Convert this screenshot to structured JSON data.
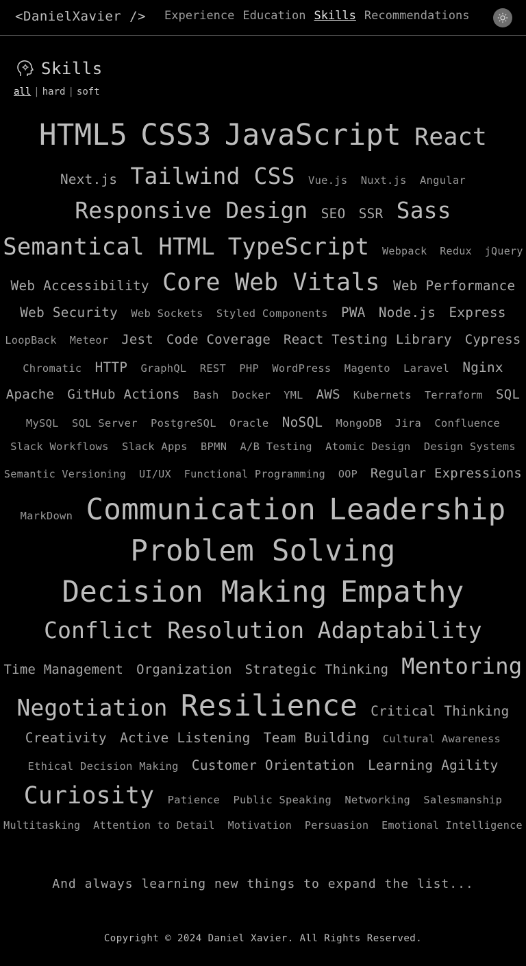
{
  "header": {
    "brand": "<DanielXavier />",
    "nav": [
      "Experience",
      "Education",
      "Skills",
      "Recommendations"
    ],
    "active_nav": "Skills",
    "theme_toggle_icon": "sun-icon"
  },
  "section": {
    "title": "Skills",
    "icon": "head-gear-icon",
    "filters": [
      "all",
      "hard",
      "soft"
    ],
    "active_filter": "all"
  },
  "skills_rows": [
    [
      [
        "HTML5",
        44
      ],
      [
        "CSS3",
        44
      ],
      [
        "JavaScript",
        44
      ],
      [
        "React",
        36
      ]
    ],
    [
      [
        "Next.js",
        20
      ],
      [
        "Tailwind CSS",
        34
      ],
      [
        "Vue.js",
        16
      ],
      [
        "Nuxt.js",
        16
      ],
      [
        "Angular",
        16
      ]
    ],
    [
      [
        "Responsive Design",
        34
      ],
      [
        "SEO",
        20
      ],
      [
        "SSR",
        20
      ],
      [
        "Sass",
        34
      ]
    ],
    [
      [
        "Semantical HTML",
        36
      ],
      [
        "TypeScript",
        36
      ],
      [
        "Webpack",
        16
      ],
      [
        "Redux",
        16
      ],
      [
        "jQuery",
        16
      ]
    ],
    [
      [
        "Web Accessibility",
        20
      ],
      [
        "Core Web Vitals",
        36
      ],
      [
        "Web Performance",
        20
      ]
    ],
    [
      [
        "Web Security",
        20
      ],
      [
        "Web Sockets",
        16
      ],
      [
        "Styled Components",
        16
      ],
      [
        "PWA",
        20
      ],
      [
        "Node.js",
        20
      ],
      [
        "Express",
        20
      ]
    ],
    [
      [
        "LoopBack",
        16
      ],
      [
        "Meteor",
        16
      ],
      [
        "Jest",
        20
      ],
      [
        "Code Coverage",
        20
      ],
      [
        "React Testing Library",
        20
      ],
      [
        "Cypress",
        20
      ]
    ],
    [
      [
        "Chromatic",
        16
      ],
      [
        "HTTP",
        20
      ],
      [
        "GraphQL",
        16
      ],
      [
        "REST",
        16
      ],
      [
        "PHP",
        16
      ],
      [
        "WordPress",
        16
      ],
      [
        "Magento",
        16
      ],
      [
        "Laravel",
        16
      ],
      [
        "Nginx",
        20
      ]
    ],
    [
      [
        "Apache",
        20
      ],
      [
        "GitHub Actions",
        20
      ],
      [
        "Bash",
        16
      ],
      [
        "Docker",
        16
      ],
      [
        "YML",
        16
      ],
      [
        "AWS",
        20
      ],
      [
        "Kubernets",
        16
      ],
      [
        "Terraform",
        16
      ],
      [
        "SQL",
        20
      ]
    ],
    [
      [
        "MySQL",
        16
      ],
      [
        "SQL Server",
        16
      ],
      [
        "PostgreSQL",
        16
      ],
      [
        "Oracle",
        16
      ],
      [
        "NoSQL",
        20
      ],
      [
        "MongoDB",
        16
      ],
      [
        "Jira",
        16
      ],
      [
        "Confluence",
        16
      ]
    ],
    [
      [
        "Slack Workflows",
        16
      ],
      [
        "Slack Apps",
        16
      ],
      [
        "BPMN",
        16
      ],
      [
        "A/B Testing",
        16
      ],
      [
        "Atomic Design",
        16
      ],
      [
        "Design Systems",
        16
      ]
    ],
    [
      [
        "Semantic Versioning",
        16
      ],
      [
        "UI/UX",
        16
      ],
      [
        "Functional Programming",
        16
      ],
      [
        "OOP",
        16
      ],
      [
        "Regular Expressions",
        20
      ]
    ],
    [
      [
        "MarkDown",
        16
      ],
      [
        "Communication",
        44
      ],
      [
        "Leadership",
        44
      ]
    ],
    [
      [
        "Problem Solving",
        44
      ]
    ],
    [
      [
        "Decision Making",
        44
      ],
      [
        "Empathy",
        44
      ]
    ],
    [
      [
        "Conflict Resolution",
        34
      ],
      [
        "Adaptability",
        34
      ]
    ],
    [
      [
        "Time Management",
        20
      ],
      [
        "Organization",
        20
      ],
      [
        "Strategic Thinking",
        20
      ],
      [
        "Mentoring",
        34
      ]
    ],
    [
      [
        "Negotiation",
        34
      ],
      [
        "Resilience",
        44
      ],
      [
        "Critical Thinking",
        20
      ]
    ],
    [
      [
        "Creativity",
        20
      ],
      [
        "Active Listening",
        20
      ],
      [
        "Team Building",
        20
      ],
      [
        "Cultural Awareness",
        16
      ]
    ],
    [
      [
        "Ethical Decision Making",
        16
      ],
      [
        "Customer Orientation",
        20
      ],
      [
        "Learning Agility",
        20
      ]
    ],
    [
      [
        "Curiosity",
        36
      ],
      [
        "Patience",
        16
      ],
      [
        "Public Speaking",
        16
      ],
      [
        "Networking",
        16
      ],
      [
        "Salesmanship",
        16
      ]
    ],
    [
      [
        "Multitasking",
        16
      ],
      [
        "Attention to Detail",
        16
      ],
      [
        "Motivation",
        16
      ],
      [
        "Persuasion",
        16
      ],
      [
        "Emotional Intelligence",
        16
      ]
    ]
  ],
  "footer": {
    "note": "And always learning new things to expand the list...",
    "copyright": "Copyright © 2024 Daniel Xavier. All Rights Reserved."
  },
  "colors": {
    "background": "#000000",
    "text": "#b0b0b0",
    "divider": "#5a5a5a",
    "toggle_bg": "#6d6d6d"
  }
}
